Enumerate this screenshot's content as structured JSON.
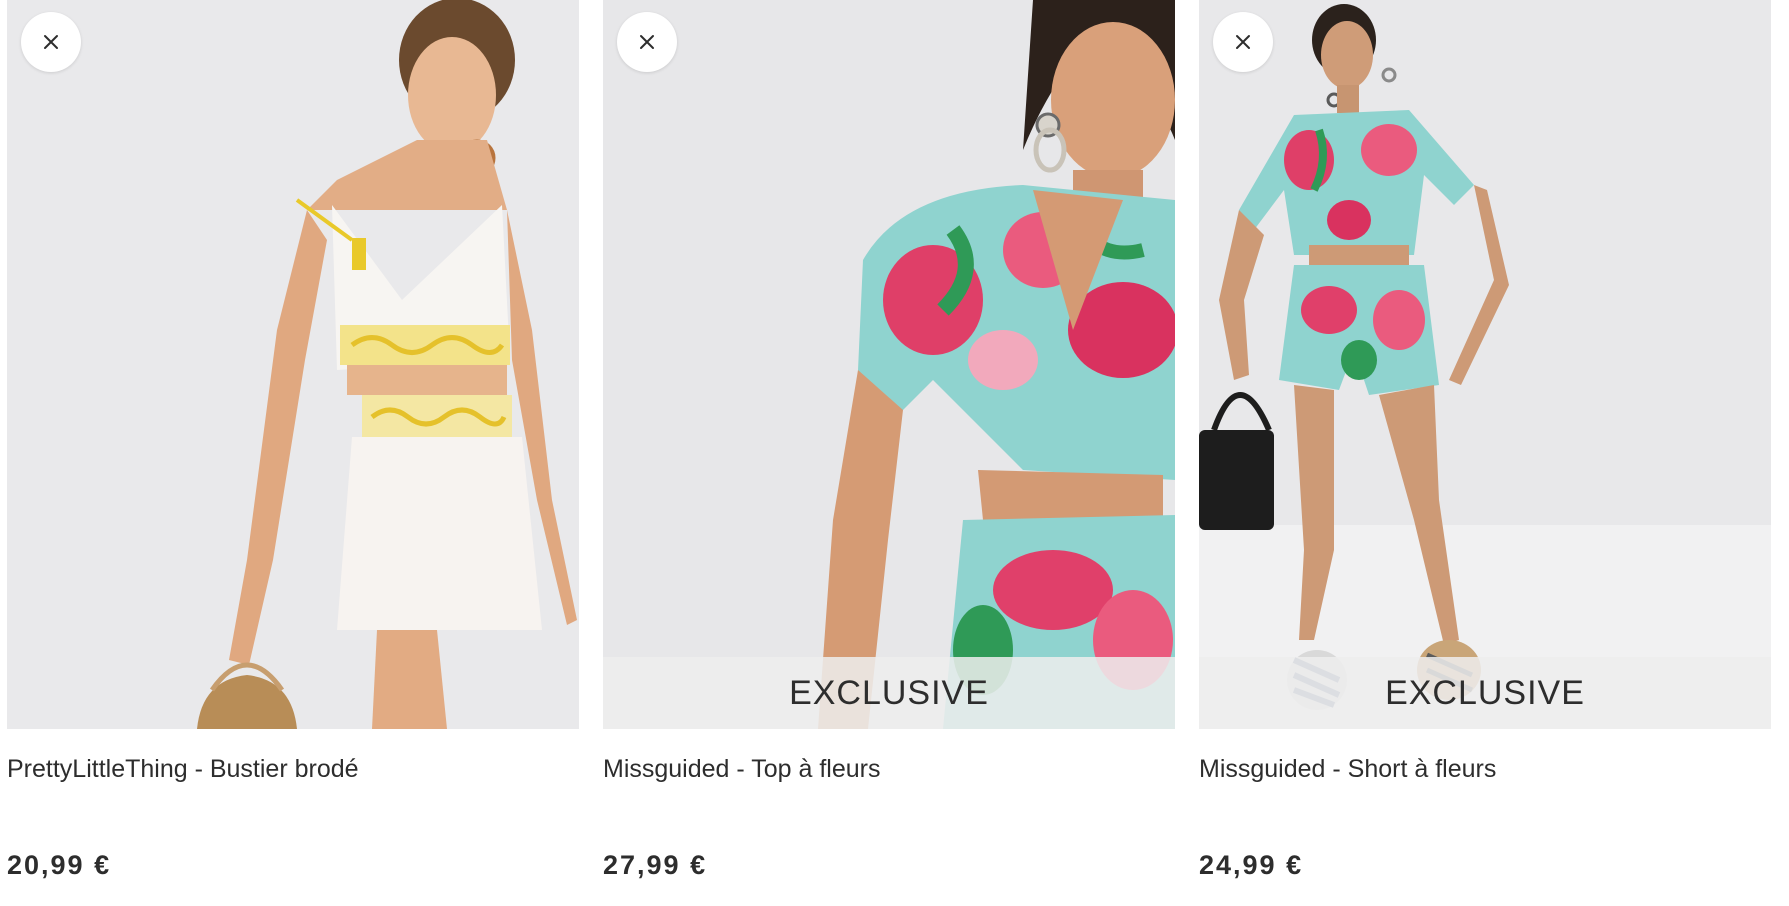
{
  "products": [
    {
      "title": "PrettyLittleThing - Bustier brodé",
      "price": "20,99 €",
      "banner": ""
    },
    {
      "title": "Missguided - Top à fleurs",
      "price": "27,99 €",
      "banner": "EXCLUSIVE"
    },
    {
      "title": "Missguided - Short à fleurs",
      "price": "24,99 €",
      "banner": "EXCLUSIVE"
    }
  ],
  "icons": {
    "remove": "close-icon"
  },
  "colors": {
    "background": "#ffffff",
    "photo_bg": "#e7e7e9",
    "text": "#2d2d2d",
    "banner_bg": "#eeeeee"
  }
}
